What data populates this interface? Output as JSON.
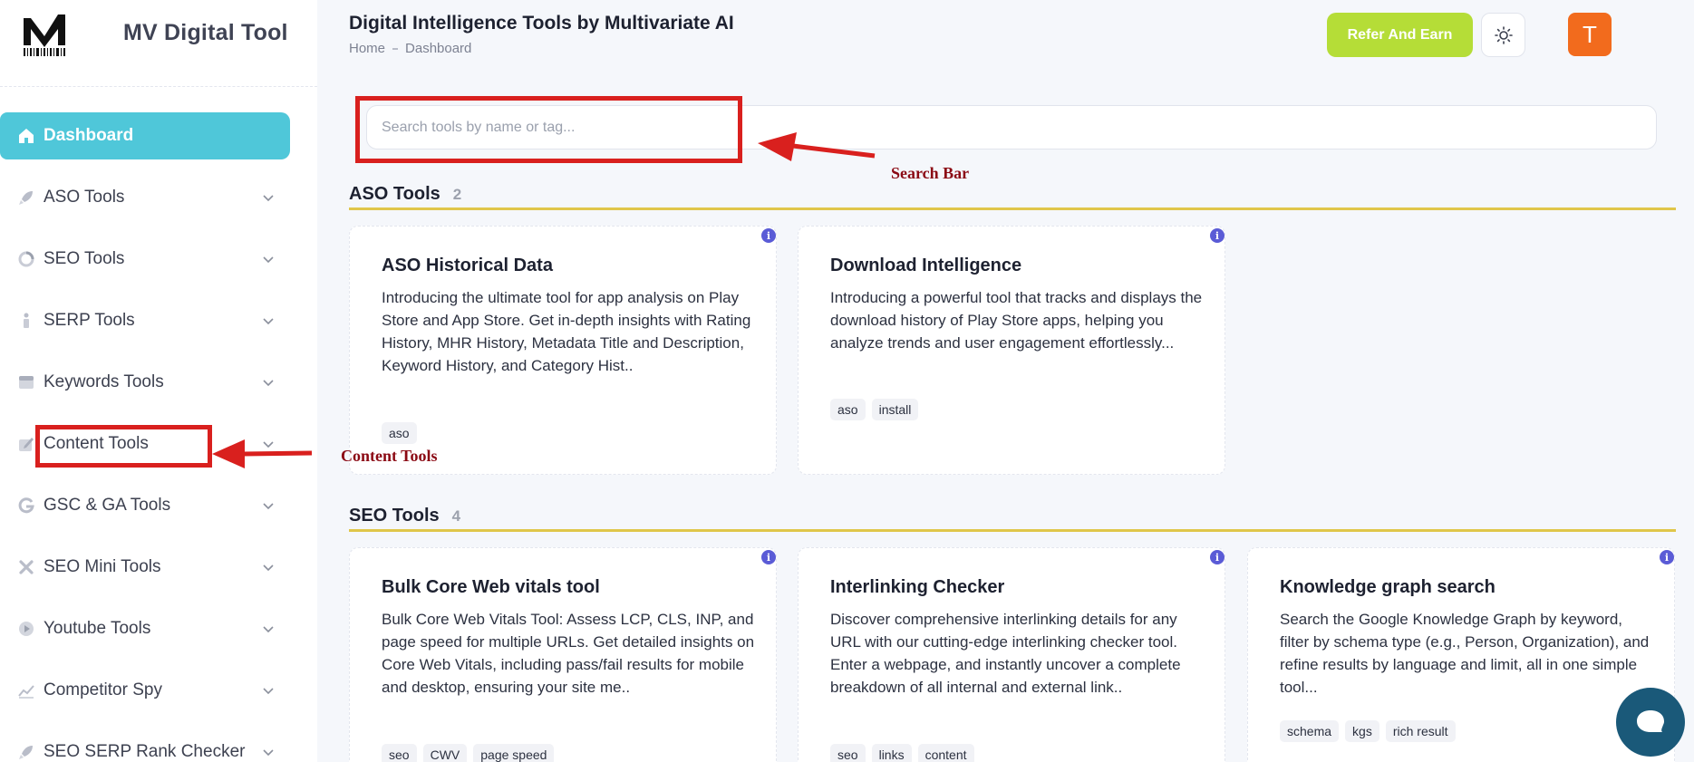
{
  "sidebar": {
    "brand": "MV Digital Tool",
    "items": [
      {
        "label": "Dashboard",
        "icon": "home-icon"
      },
      {
        "label": "ASO Tools",
        "icon": "rocket-icon"
      },
      {
        "label": "SEO Tools",
        "icon": "donut-chart-icon"
      },
      {
        "label": "SERP Tools",
        "icon": "bar-chart-icon"
      },
      {
        "label": "Keywords Tools",
        "icon": "calendar-icon"
      },
      {
        "label": "Content Tools",
        "icon": "pencil-icon"
      },
      {
        "label": "GSC & GA Tools",
        "icon": "google-icon"
      },
      {
        "label": "SEO Mini Tools",
        "icon": "tools-icon"
      },
      {
        "label": "Youtube Tools",
        "icon": "play-icon"
      },
      {
        "label": "Competitor Spy",
        "icon": "trend-icon"
      },
      {
        "label": "SEO SERP Rank Checker",
        "icon": "rocket-icon"
      }
    ]
  },
  "header": {
    "title": "Digital Intelligence Tools by Multivariate AI",
    "breadcrumb": [
      "Home",
      "Dashboard"
    ],
    "refer_label": "Refer And Earn",
    "avatar_initial": "T"
  },
  "search": {
    "placeholder": "Search tools by name or tag...",
    "value": ""
  },
  "sections": [
    {
      "title": "ASO Tools",
      "count": "2",
      "cards": [
        {
          "title": "ASO Historical Data",
          "desc": "Introducing the ultimate tool for app analysis on Play Store and App Store. Get in-depth insights with Rating History, MHR History, Metadata Title and Description, Keyword History, and Category Hist..",
          "tags": [
            "aso"
          ]
        },
        {
          "title": "Download Intelligence",
          "desc": "Introducing a powerful tool that tracks and displays the download history of Play Store apps, helping you analyze trends and user engagement effortlessly...",
          "tags": [
            "aso",
            "install"
          ]
        }
      ]
    },
    {
      "title": "SEO Tools",
      "count": "4",
      "cards": [
        {
          "title": "Bulk Core Web vitals tool",
          "desc": "Bulk Core Web Vitals Tool: Assess LCP, CLS, INP, and page speed for multiple URLs. Get detailed insights on Core Web Vitals, including pass/fail results for mobile and desktop, ensuring your site me..",
          "tags": [
            "seo",
            "CWV",
            "page speed"
          ]
        },
        {
          "title": "Interlinking Checker",
          "desc": "Discover comprehensive interlinking details for any URL with our cutting-edge interlinking checker tool. Enter a webpage, and instantly uncover a complete breakdown of all internal and external link..",
          "tags": [
            "seo",
            "links",
            "content"
          ]
        },
        {
          "title": "Knowledge graph search",
          "desc": "Search the Google Knowledge Graph by keyword, filter by schema type (e.g., Person, Organization), and refine results by language and limit, all in one simple tool...",
          "tags": [
            "schema",
            "kgs",
            "rich result"
          ]
        }
      ]
    }
  ],
  "annotations": {
    "search_label": "Search Bar",
    "content_label": "Content Tools",
    "color": "#d9201e"
  },
  "colors": {
    "accent": "#4fc7d9",
    "refer": "#b5dd37",
    "avatar": "#f26b1d",
    "section_rule": "#e0c64a",
    "chat": "#1a5979"
  }
}
